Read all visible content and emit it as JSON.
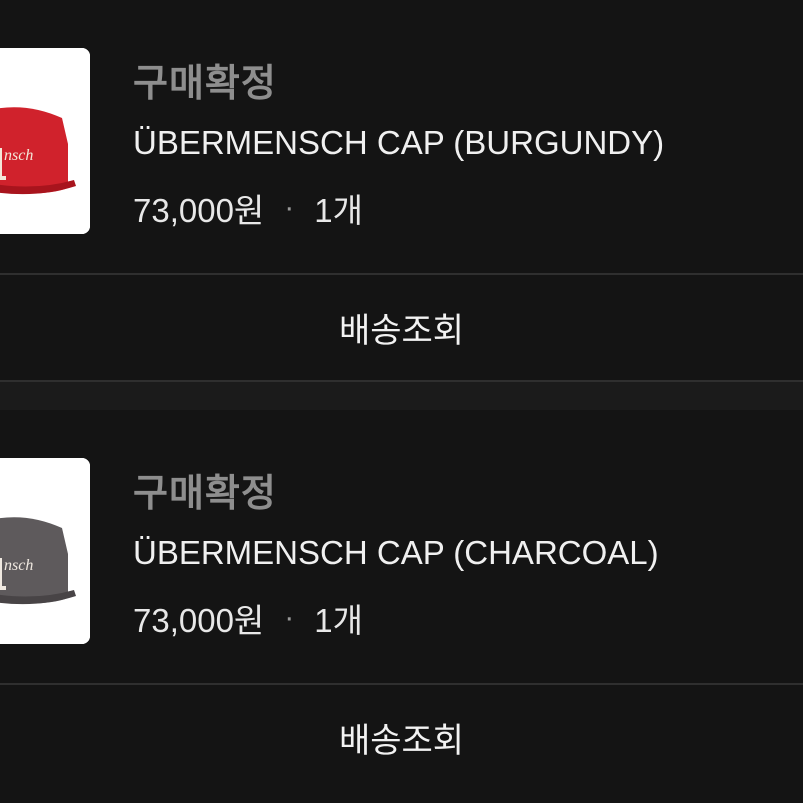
{
  "orders": [
    {
      "status": "구매확정",
      "product_name": "ÜBERMENSCH CAP (BURGUNDY)",
      "price": "73,000원",
      "separator": "·",
      "quantity": "1개",
      "track_label": "배송조회",
      "cap_color": "#d0222c",
      "cap_shade": "#a8141d",
      "logo_text": "nsch"
    },
    {
      "status": "구매확정",
      "product_name": "ÜBERMENSCH CAP (CHARCOAL)",
      "price": "73,000원",
      "separator": "·",
      "quantity": "1개",
      "track_label": "배송조회",
      "cap_color": "#5e5a5c",
      "cap_shade": "#484446",
      "logo_text": "nsch"
    }
  ]
}
